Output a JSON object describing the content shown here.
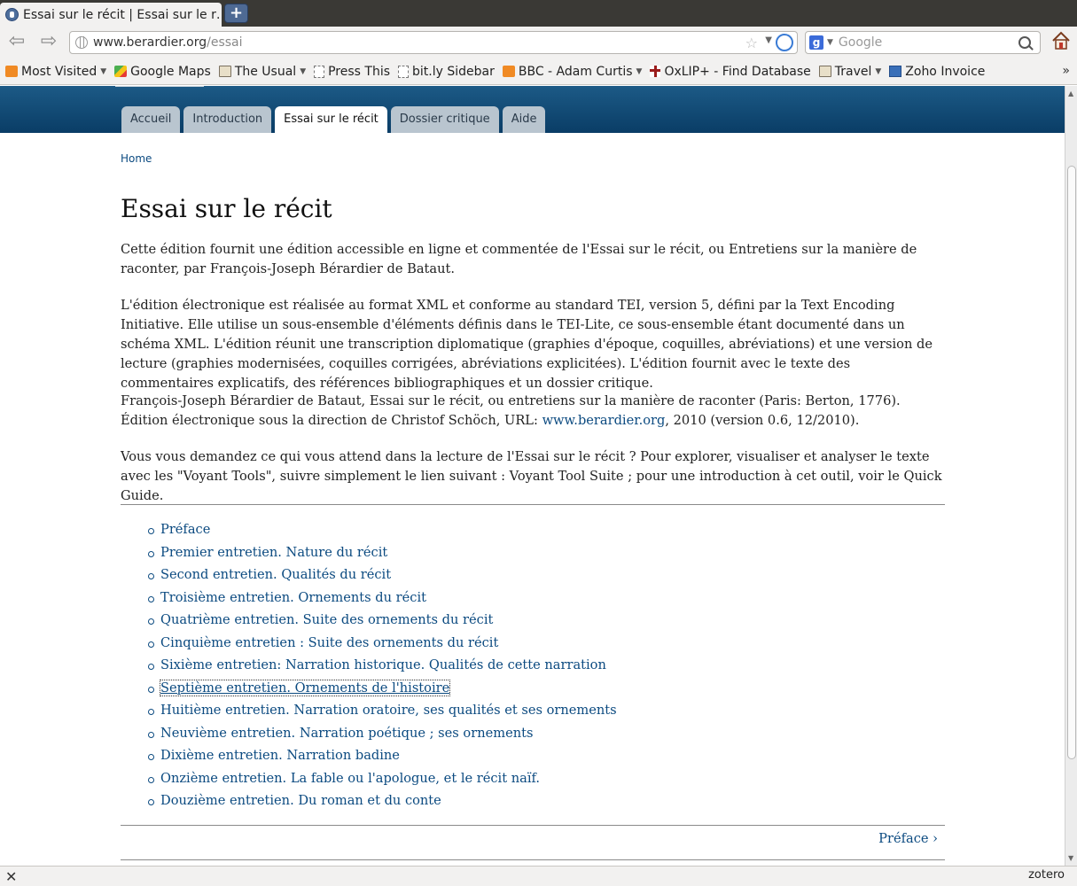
{
  "browser": {
    "tab_title": "Essai sur le récit | Essai sur le r…",
    "new_tab": "+",
    "url_host": "www.berardier.org",
    "url_path": "/essai",
    "search_placeholder": "Google",
    "search_engine_letter": "g",
    "bookmarks": [
      {
        "label": "Most Visited",
        "icon": "rss-folder-icon",
        "dropdown": true
      },
      {
        "label": "Google Maps",
        "icon": "maps-icon",
        "dropdown": false
      },
      {
        "label": "The Usual",
        "icon": "folder-icon",
        "dropdown": true
      },
      {
        "label": "Press This",
        "icon": "page-icon",
        "dropdown": false
      },
      {
        "label": "bit.ly Sidebar",
        "icon": "page-icon",
        "dropdown": false
      },
      {
        "label": "BBC - Adam Curtis",
        "icon": "rss-icon",
        "dropdown": true
      },
      {
        "label": "OxLIP+ - Find Database",
        "icon": "oxlip-icon",
        "dropdown": false
      },
      {
        "label": "Travel",
        "icon": "folder-icon",
        "dropdown": true
      },
      {
        "label": "Zoho Invoice",
        "icon": "zoho-icon",
        "dropdown": false
      }
    ],
    "overflow": "»",
    "status_right": "zotero"
  },
  "site": {
    "tabs": [
      "Accueil",
      "Introduction",
      "Essai sur le récit",
      "Dossier critique",
      "Aide"
    ],
    "active_tab": "Essai sur le récit",
    "header_color": "#0f4a74"
  },
  "page": {
    "breadcrumb": "Home",
    "title": "Essai sur le récit",
    "para1": "Cette édition fournit une édition accessible en ligne et commentée de l'Essai sur le récit, ou Entretiens sur la manière de raconter, par François-Joseph Bérardier de Bataut.",
    "para2": "L'édition électronique est réalisée au format XML et conforme au standard TEI, version 5, défini par la Text Encoding Initiative. Elle utilise un sous-ensemble d'éléments définis dans le TEI-Lite, ce sous-ensemble étant documenté dans un schéma XML. L'édition réunit une transcription diplomatique (graphies d'époque, coquilles, abréviations) et une version de lecture (graphies modernisées, coquilles corrigées, abréviations explicitées). L'édition fournit avec le texte des commentaires explicatifs, des références bibliographiques et un dossier critique.",
    "para3_before": "François-Joseph Bérardier de Bataut, Essai sur le récit, ou entretiens sur la manière de raconter (Paris: Berton, 1776). Édition électronique sous la direction de Christof Schöch, URL: ",
    "para3_link": "www.berardier.org",
    "para3_after": ", 2010 (version 0.6, 12/2010).",
    "para4": "Vous vous demandez ce qui vous attend dans la lecture de l'Essai sur le récit ? Pour explorer, visualiser et analyser le texte avec les \"Voyant Tools\", suivre simplement le lien suivant : Voyant Tool Suite ; pour une introduction à cet outil, voir le Quick Guide.",
    "toc": [
      "Préface",
      "Premier entretien. Nature du récit",
      "Second entretien. Qualités du récit",
      "Troisième entretien. Ornements du récit",
      "Quatrième entretien. Suite des ornements du récit",
      "Cinquième entretien : Suite des ornements du récit",
      "Sixième entretien: Narration historique. Qualités de cette narration",
      "Septième entretien. Ornements de l'histoire",
      "Huitième entretien. Narration oratoire, ses qualités et ses ornements",
      "Neuvième entretien. Narration poétique ; ses ornements",
      "Dixième entretien. Narration badine",
      "Onzième entretien. La fable ou l'apologue, et le récit naïf.",
      "Douzième entretien. Du roman et du conte"
    ],
    "focused_toc_item": "Septième entretien. Ornements de l'histoire",
    "next_link": "Préface ›",
    "link_color": "#0b4a80"
  }
}
